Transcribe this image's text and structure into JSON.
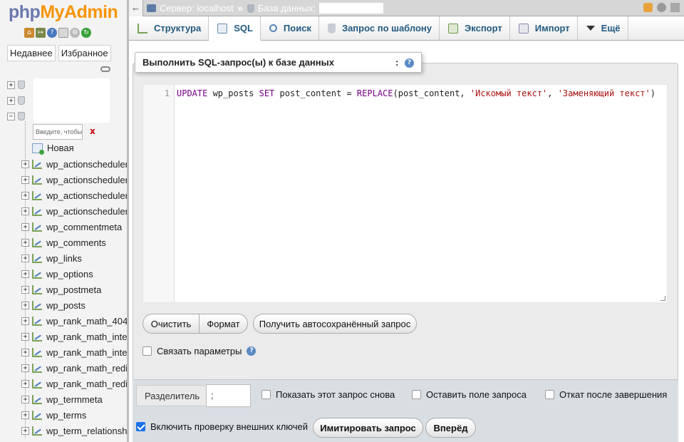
{
  "nav": {
    "logo_php": "php",
    "logo_myadmin": "MyAdmin",
    "recent_label": "Недавнее",
    "favorites_label": "Избранное",
    "filter_placeholder": "Введите, чтобы",
    "filter_clear": "x",
    "new_label": "Новая",
    "tables": [
      "wp_actionscheduler",
      "wp_actionscheduler",
      "wp_actionscheduler",
      "wp_actionscheduler",
      "wp_commentmeta",
      "wp_comments",
      "wp_links",
      "wp_options",
      "wp_postmeta",
      "wp_posts",
      "wp_rank_math_404",
      "wp_rank_math_inte",
      "wp_rank_math_inte",
      "wp_rank_math_redi",
      "wp_rank_math_redi",
      "wp_termmeta",
      "wp_terms",
      "wp_term_relationsh"
    ]
  },
  "topbar": {
    "back": "←",
    "server_label": "Сервер: localhost",
    "separator": "»",
    "database_label": "База данных:"
  },
  "tabs": [
    {
      "label": "Структура",
      "icon": "structure-icon"
    },
    {
      "label": "SQL",
      "icon": "sql-icon"
    },
    {
      "label": "Поиск",
      "icon": "search-icon"
    },
    {
      "label": "Запрос по шаблону",
      "icon": "query-icon"
    },
    {
      "label": "Экспорт",
      "icon": "export-icon"
    },
    {
      "label": "Импорт",
      "icon": "import-icon"
    },
    {
      "label": "Ещё",
      "icon": "chevron-down-icon"
    }
  ],
  "sql": {
    "legend": "Выполнить SQL-запрос(ы) к базе данных",
    "legend_colon": ":",
    "line_number": "1",
    "code": {
      "kw1": "UPDATE",
      "t1": " wp_posts ",
      "kw2": "SET",
      "t2": " post_content ",
      "eq": "=",
      "t3": " ",
      "fn": "REPLACE",
      "t4": "(post_content, ",
      "s1": "'Искомый текст'",
      "t5": ", ",
      "s2": "'Заменяющий текст'",
      "t6": ")"
    },
    "clear_button": "Очистить",
    "format_button": "Формат",
    "autosave_button": "Получить автосохранённый запрос",
    "bind_params_label": "Связать параметры"
  },
  "options": {
    "delimiter_label": "Разделитель",
    "delimiter_value": ";",
    "show_query_label": "Показать этот запрос снова",
    "keep_box_label": "Оставить поле запроса",
    "rollback_label": "Откат после завершения",
    "fk_check_label": "Включить проверку внешних ключей",
    "simulate_button": "Имитировать запрос",
    "go_button": "Вперёд"
  },
  "colors": {
    "accent_text": "#235a81",
    "logo_php": "#6c78af",
    "logo_myadmin": "#f89406",
    "checkbox_on": "#1a73e8"
  }
}
